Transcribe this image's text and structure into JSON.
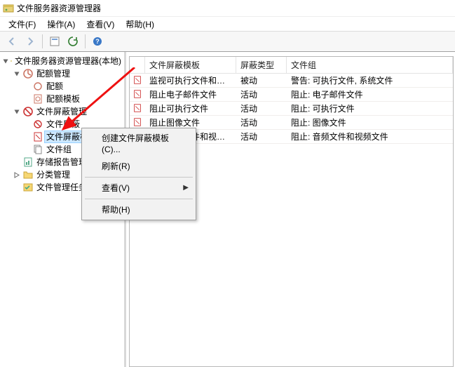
{
  "window": {
    "title": "文件服务器资源管理器"
  },
  "menubar": {
    "file": "文件(F)",
    "action": "操作(A)",
    "view": "查看(V)",
    "help": "帮助(H)"
  },
  "tree": {
    "root": "文件服务器资源管理器(本地)",
    "nodes": {
      "quota_mgmt": "配额管理",
      "quota": "配额",
      "quota_tpl": "配额模板",
      "screen_mgmt": "文件屏蔽管理",
      "screen": "文件屏蔽",
      "screen_tpl": "文件屏蔽模板",
      "filegroup": "文件组",
      "storage_rpt": "存储报告管理",
      "class_mgmt": "分类管理",
      "fm_tasks": "文件管理任务"
    }
  },
  "columns": {
    "c1": "文件屏蔽模板",
    "c2": "屏蔽类型",
    "c3": "文件组"
  },
  "rows": [
    {
      "c1": "监视可执行文件和系统文件",
      "c2": "被动",
      "c3": "警告: 可执行文件, 系统文件"
    },
    {
      "c1": "阻止电子邮件文件",
      "c2": "活动",
      "c3": "阻止: 电子邮件文件"
    },
    {
      "c1": "阻止可执行文件",
      "c2": "活动",
      "c3": "阻止: 可执行文件"
    },
    {
      "c1": "阻止图像文件",
      "c2": "活动",
      "c3": "阻止: 图像文件"
    },
    {
      "c1": "阻止音频文件和视频文件",
      "c2": "活动",
      "c3": "阻止: 音频文件和视频文件"
    }
  ],
  "context": {
    "create_tpl": "创建文件屏蔽模板(C)...",
    "refresh": "刷新(R)",
    "view": "查看(V)",
    "help": "帮助(H)"
  }
}
